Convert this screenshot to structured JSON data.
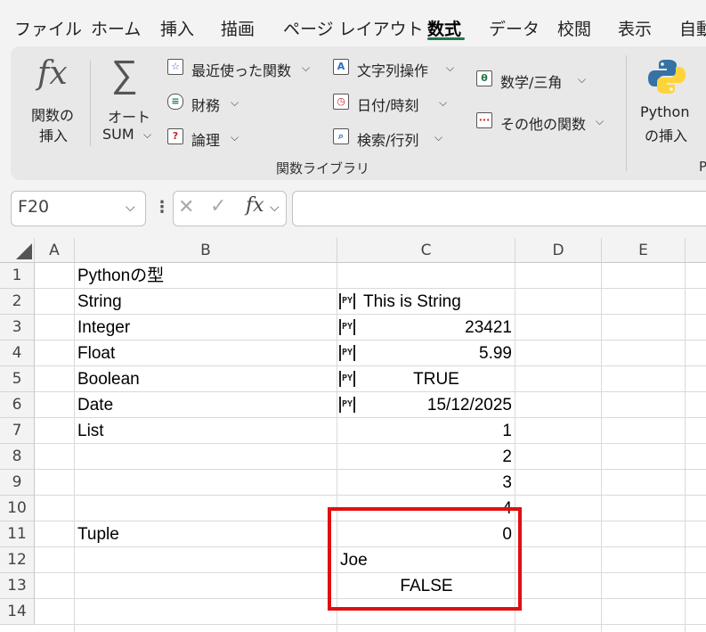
{
  "menu": {
    "tabs": [
      "ファイル",
      "ホーム",
      "挿入",
      "描画",
      "ページ レイアウト",
      "数式",
      "データ",
      "校閲",
      "表示",
      "自動"
    ],
    "active_tab": "数式"
  },
  "ribbon": {
    "insert_function": {
      "icon": "fx",
      "label1": "関数の",
      "label2": "挿入"
    },
    "autosum": {
      "icon": "∑",
      "label1": "オート",
      "label2": "SUM"
    },
    "recent": "最近使った関数",
    "financial": "財務",
    "logical": "論理",
    "text": "文字列操作",
    "datetime": "日付/時刻",
    "lookup": "検索/行列",
    "math": "数学/三角",
    "more": "その他の関数",
    "python": {
      "label1": "Python",
      "label2": "の挿入"
    },
    "group_label": "関数ライブラリ",
    "cut_label": "P"
  },
  "formula_bar": {
    "name_box": "F20",
    "fx": "fx",
    "formula": ""
  },
  "sheet": {
    "columns": [
      "A",
      "B",
      "C",
      "D",
      "E"
    ],
    "rows": [
      "1",
      "2",
      "3",
      "4",
      "5",
      "6",
      "7",
      "8",
      "9",
      "10",
      "11",
      "12",
      "13",
      "14"
    ],
    "py_badge": "PY",
    "cells": {
      "B1": "Pythonの型",
      "B2": "String",
      "C2": "This is String",
      "B3": "Integer",
      "C3": "23421",
      "B4": "Float",
      "C4": "5.99",
      "B5": "Boolean",
      "C5": "TRUE",
      "B6": "Date",
      "C6": "15/12/2025",
      "B7": "List",
      "C7": "1",
      "C8": "2",
      "C9": "3",
      "C10": "4",
      "B11": "Tuple",
      "C11": "0",
      "C12": "Joe",
      "C13": "FALSE"
    }
  },
  "colors": {
    "accent_green": "#1e7c45",
    "highlight_red": "#e01010",
    "python_blue": "#3572a5",
    "python_yellow": "#ffd43b"
  }
}
